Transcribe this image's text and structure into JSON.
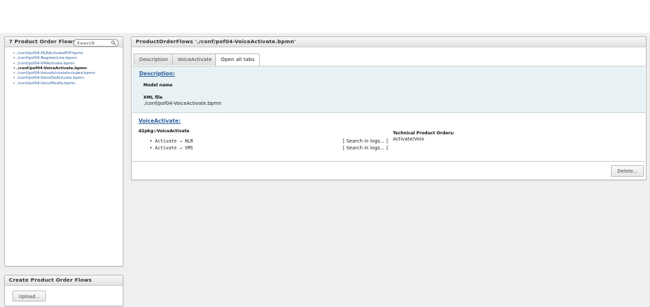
{
  "sidebar": {
    "title": "7 Product Order Flows",
    "search_placeholder": "Search",
    "items": [
      "./conf/pof04-HLRActivatePOF.bpmn",
      "./conf/pof04-RegisterLine.bpmn",
      "./conf/pof04-VMActivate.bpmn",
      "./conf/pof04-VoiceActivate.bpmn",
      "./conf/pof04-VoiceActivateIncluded.bpmn",
      "./conf/pof04-VoiceDeActivate.bpmn",
      "./conf/pof04-VoiceModify.bpmn"
    ],
    "active_index": 3
  },
  "create": {
    "title": "Create Product Order Flows",
    "upload_label": "Upload..."
  },
  "main": {
    "title": "ProductOrderFlows './conf/pof04-VoiceActivate.bpmn'",
    "tabs": [
      "Description",
      "VoiceActivate",
      "Open all tabs"
    ],
    "active_tab": 2,
    "description": {
      "heading": "Description:",
      "model_name_label": "Model name",
      "xml_file_label": "XML file",
      "xml_file_value": "./conf/pof04-VoiceActivate.bpmn"
    },
    "voice": {
      "heading": "VoiceActivate:",
      "package": "d2pkg::VoiceActivate",
      "steps": [
        "Activate → HLR",
        "Activate → VMS"
      ],
      "search_logs": "[ Search in logs... ]",
      "tpo_label": "Technical Product Orders:",
      "tpo_value": "Activate/Voix"
    },
    "delete_label": "Delete..."
  }
}
